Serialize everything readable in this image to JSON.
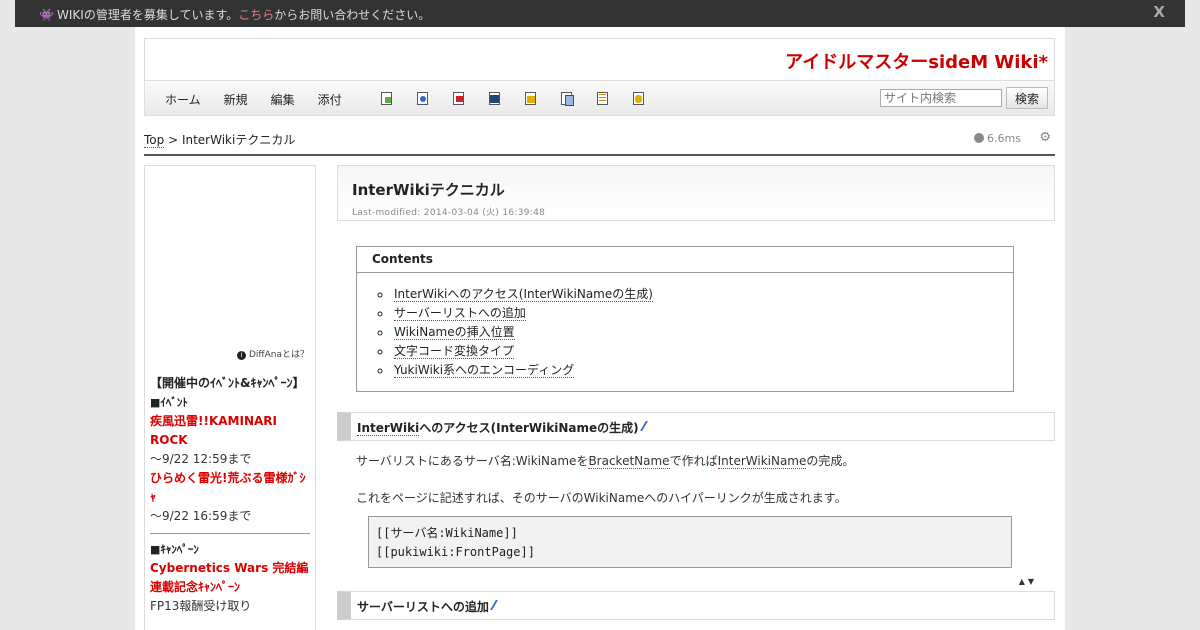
{
  "notice": {
    "bug_icon": "bug-icon",
    "text_before": "WIKIの管理者を募集しています。",
    "link": "こちら",
    "text_after": "からお問い合わせください。",
    "close": "X"
  },
  "site": {
    "title": "アイドルマスターsideM Wiki*"
  },
  "nav": {
    "items": [
      "ホーム",
      "新規",
      "編集",
      "添付"
    ],
    "search_placeholder": "サイト内検索",
    "search_button": "検索"
  },
  "breadcrumb": {
    "top": "Top",
    "sep": " > ",
    "current": "InterWikiテクニカル"
  },
  "stats": {
    "time": "6.6ms"
  },
  "sidebar": {
    "diffana": "DiffAnaとは？",
    "heading": "【開催中のｲﾍﾞﾝﾄ&ｷｬﾝﾍﾟｰﾝ】",
    "event_label": "■ｲﾍﾞﾝﾄ",
    "event1": "疾風迅雷!!KAMINARI ROCK",
    "event1_date": "～9/22 12:59まで",
    "event2": "ひらめく雷光!荒ぶる雷様ｶﾞｼｬ",
    "event2_date": "～9/22 16:59まで",
    "campaign_label": "■ｷｬﾝﾍﾟｰﾝ",
    "campaign1": "Cybernetics Wars 完結編連載記念ｷｬﾝﾍﾟｰﾝ",
    "campaign1_note": "FP13報酬受け取り"
  },
  "page": {
    "title": "InterWikiテクニカル",
    "last_modified": "Last-modified: 2014-03-04 (火) 16:39:48"
  },
  "contents": {
    "heading": "Contents",
    "items": [
      "InterWikiへのアクセス(InterWikiNameの生成)",
      "サーバーリストへの追加",
      "WikiNameの挿入位置",
      "文字コード変換タイプ",
      "YukiWiki系へのエンコーディング"
    ]
  },
  "section1": {
    "heading_link": "InterWiki",
    "heading_rest": "へのアクセス(InterWikiNameの生成)",
    "p1_a": "サーバリストにあるサーバ名:WikiNameを",
    "p1_link1": "BracketName",
    "p1_b": "で作れば",
    "p1_link2": "InterWikiName",
    "p1_c": "の完成。",
    "p2": "これをページに記述すれば、そのサーバのWikiNameへのハイパーリンクが生成されます。",
    "code1": "[[サーバ名:WikiName]]",
    "code2": "[[pukiwiki:FrontPage]]",
    "arrows": "▲▼"
  },
  "section2": {
    "heading": "サーバーリストへの追加"
  }
}
